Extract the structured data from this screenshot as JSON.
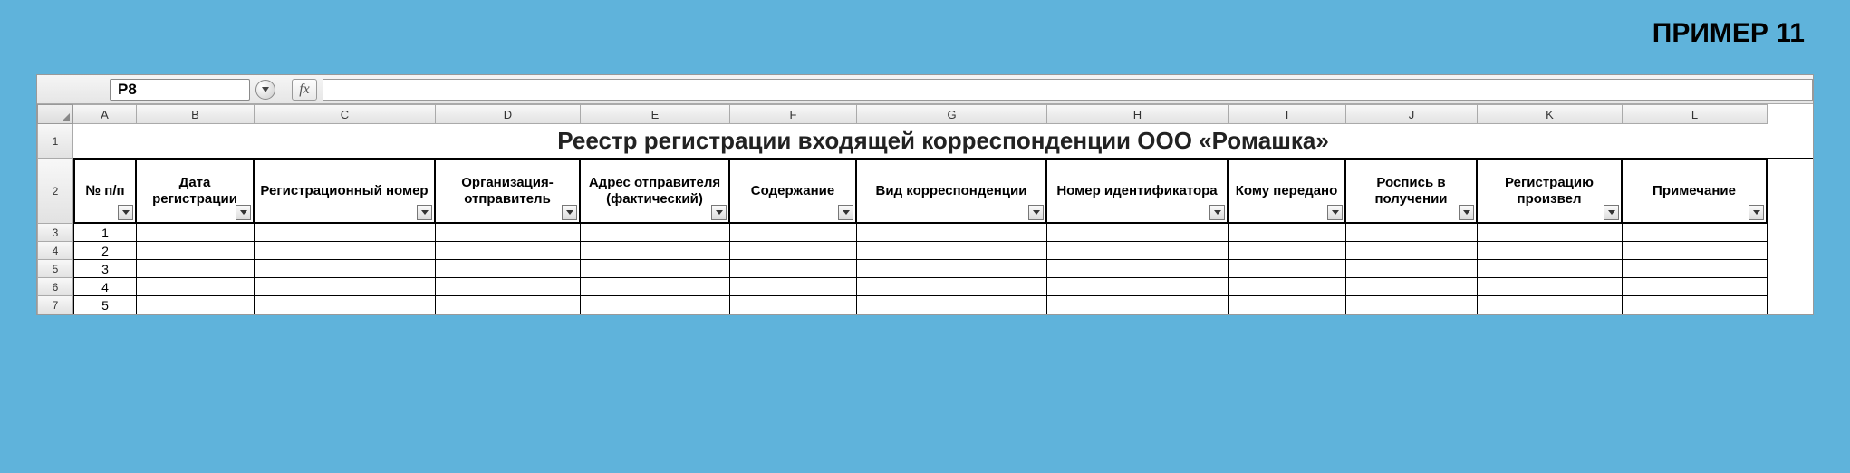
{
  "caption": "ПРИМЕР 11",
  "namebox": "P8",
  "fx_label": "fx",
  "columns": [
    "A",
    "B",
    "C",
    "D",
    "E",
    "F",
    "G",
    "H",
    "I",
    "J",
    "K",
    "L"
  ],
  "row_numbers": [
    "1",
    "2",
    "3",
    "4",
    "5",
    "6",
    "7"
  ],
  "title": "Реестр регистрации входящей корреспонденции ООО «Ромашка»",
  "headers": [
    "№ п/п",
    "Дата регистрации",
    "Регистрационный номер",
    "Организация-отправитель",
    "Адрес отправителя (фактический)",
    "Содержание",
    "Вид корреспонденции",
    "Номер идентификатора",
    "Кому передано",
    "Роспись в получении",
    "Регистрацию произвел",
    "Примечание"
  ],
  "data_rows": [
    {
      "num": "1",
      "cells": [
        "",
        "",
        "",
        "",
        "",
        "",
        "",
        "",
        "",
        "",
        ""
      ]
    },
    {
      "num": "2",
      "cells": [
        "",
        "",
        "",
        "",
        "",
        "",
        "",
        "",
        "",
        "",
        ""
      ]
    },
    {
      "num": "3",
      "cells": [
        "",
        "",
        "",
        "",
        "",
        "",
        "",
        "",
        "",
        "",
        ""
      ]
    },
    {
      "num": "4",
      "cells": [
        "",
        "",
        "",
        "",
        "",
        "",
        "",
        "",
        "",
        "",
        ""
      ]
    },
    {
      "num": "5",
      "cells": [
        "",
        "",
        "",
        "",
        "",
        "",
        "",
        "",
        "",
        "",
        ""
      ]
    }
  ]
}
